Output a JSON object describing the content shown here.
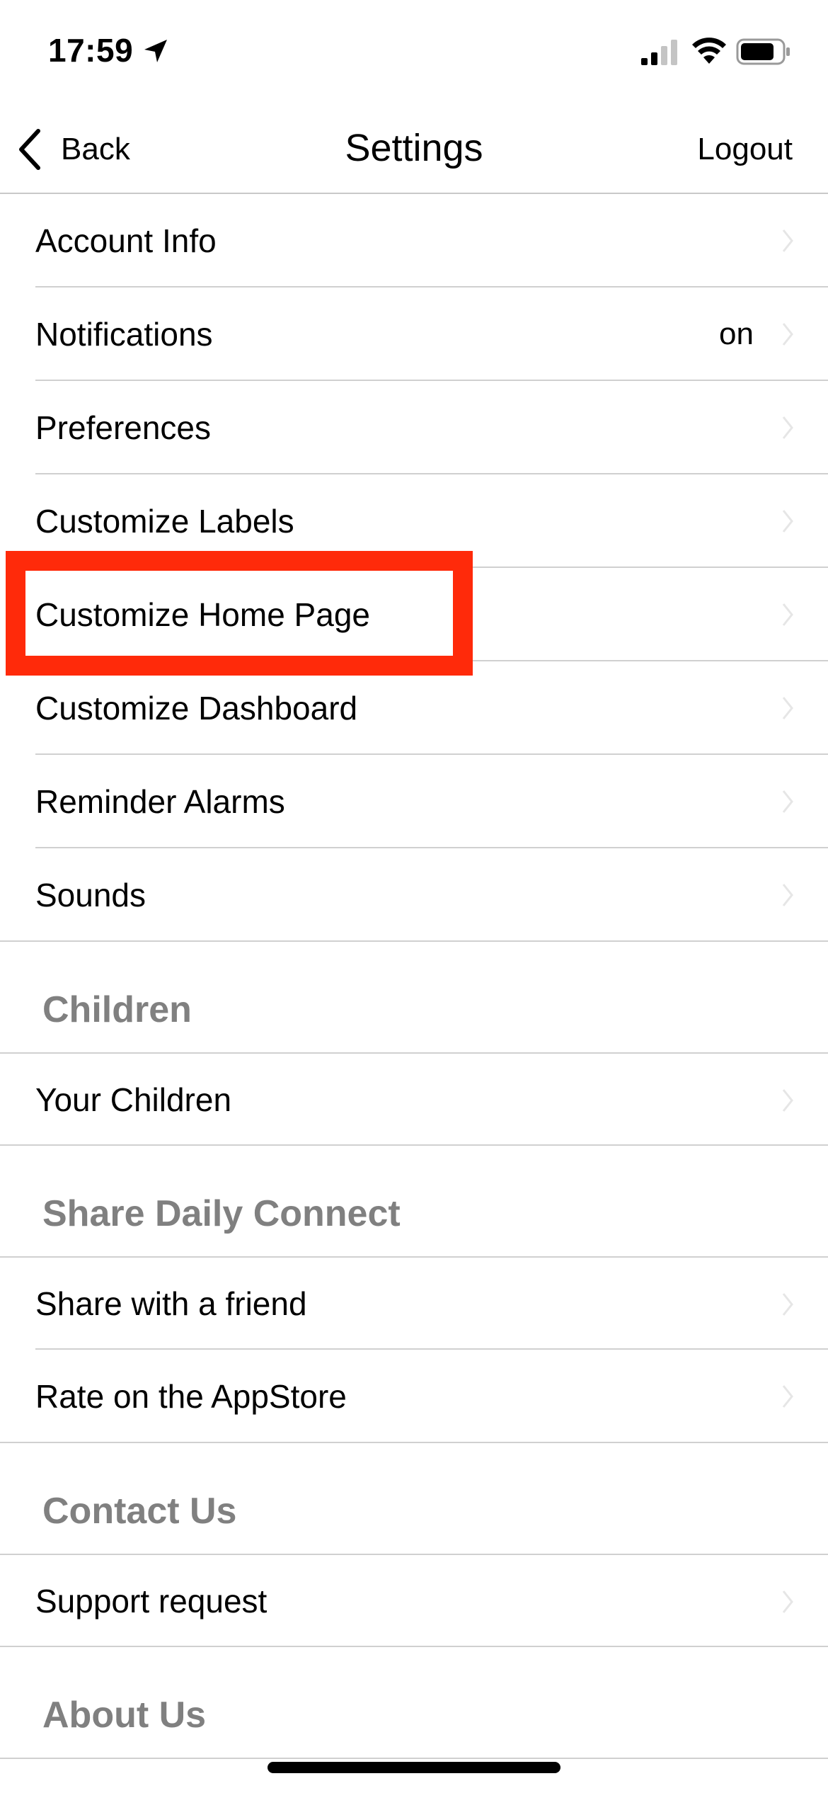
{
  "status_bar": {
    "time": "17:59"
  },
  "nav": {
    "back_label": "Back",
    "title": "Settings",
    "logout_label": "Logout"
  },
  "settings_items": [
    {
      "label": "Account Info",
      "value": ""
    },
    {
      "label": "Notifications",
      "value": "on"
    },
    {
      "label": "Preferences",
      "value": ""
    },
    {
      "label": "Customize Labels",
      "value": ""
    },
    {
      "label": "Customize Home Page",
      "value": "",
      "highlighted": true
    },
    {
      "label": "Customize Dashboard",
      "value": ""
    },
    {
      "label": "Reminder Alarms",
      "value": ""
    },
    {
      "label": "Sounds",
      "value": ""
    }
  ],
  "sections": {
    "children": {
      "title": "Children",
      "items": [
        {
          "label": "Your Children"
        }
      ]
    },
    "share": {
      "title": "Share Daily Connect",
      "items": [
        {
          "label": "Share with a friend"
        },
        {
          "label": "Rate on the AppStore"
        }
      ]
    },
    "contact": {
      "title": "Contact Us",
      "items": [
        {
          "label": "Support request"
        }
      ]
    },
    "about": {
      "title": "About Us"
    }
  },
  "colors": {
    "highlight": "#ff2a0a",
    "section_header": "#808080",
    "separator": "#d0d0d0",
    "chevron": "#e6e6e6"
  }
}
